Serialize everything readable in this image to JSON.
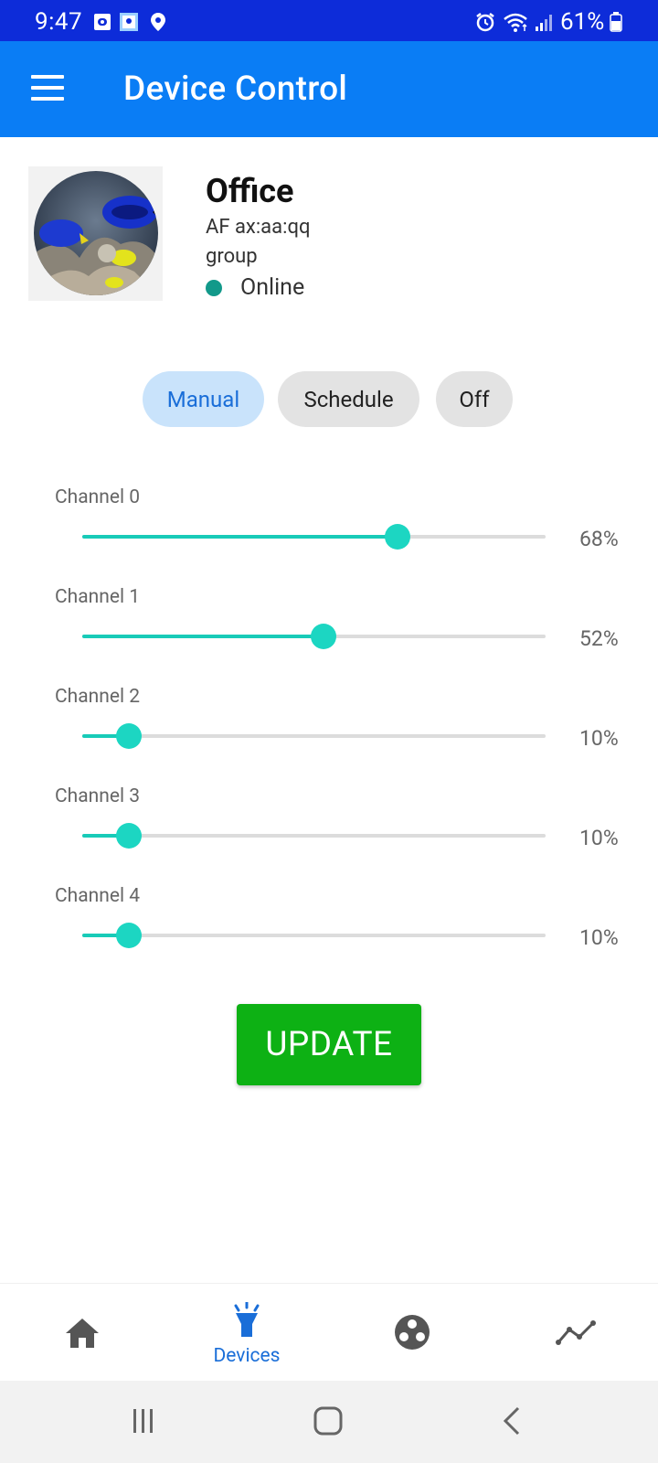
{
  "status_bar": {
    "time": "9:47",
    "battery": "61%",
    "icons": [
      "outlook-icon",
      "maps-icon",
      "location-icon",
      "alarm-icon",
      "wifi-icon",
      "signal-icon",
      "battery-icon"
    ]
  },
  "app_bar": {
    "title": "Device Control",
    "menu_icon": "hamburger-menu-icon"
  },
  "device": {
    "name": "Office",
    "id": "AF ax:aa:qq",
    "group": "group",
    "status": "Online",
    "status_color": "#12998a"
  },
  "modes": [
    {
      "label": "Manual",
      "active": true
    },
    {
      "label": "Schedule",
      "active": false
    },
    {
      "label": "Off",
      "active": false
    }
  ],
  "channels": [
    {
      "label": "Channel 0",
      "value": 68,
      "value_text": "68%"
    },
    {
      "label": "Channel 1",
      "value": 52,
      "value_text": "52%"
    },
    {
      "label": "Channel 2",
      "value": 10,
      "value_text": "10%"
    },
    {
      "label": "Channel 3",
      "value": 10,
      "value_text": "10%"
    },
    {
      "label": "Channel 4",
      "value": 10,
      "value_text": "10%"
    }
  ],
  "update_button": {
    "label": "UPDATE",
    "color": "#0db114"
  },
  "bottom_nav": {
    "items": [
      {
        "icon": "home-icon",
        "label": ""
      },
      {
        "icon": "flashlight-icon",
        "label": "Devices",
        "active": true
      },
      {
        "icon": "groups-icon",
        "label": ""
      },
      {
        "icon": "chart-line-icon",
        "label": ""
      }
    ],
    "active_color": "#1a6ed8"
  },
  "colors": {
    "status_bar": "#0d2cd9",
    "app_bar": "#0a7df5",
    "slider_accent": "#1cd6c2",
    "chip_active_bg": "#c9e3fb"
  }
}
